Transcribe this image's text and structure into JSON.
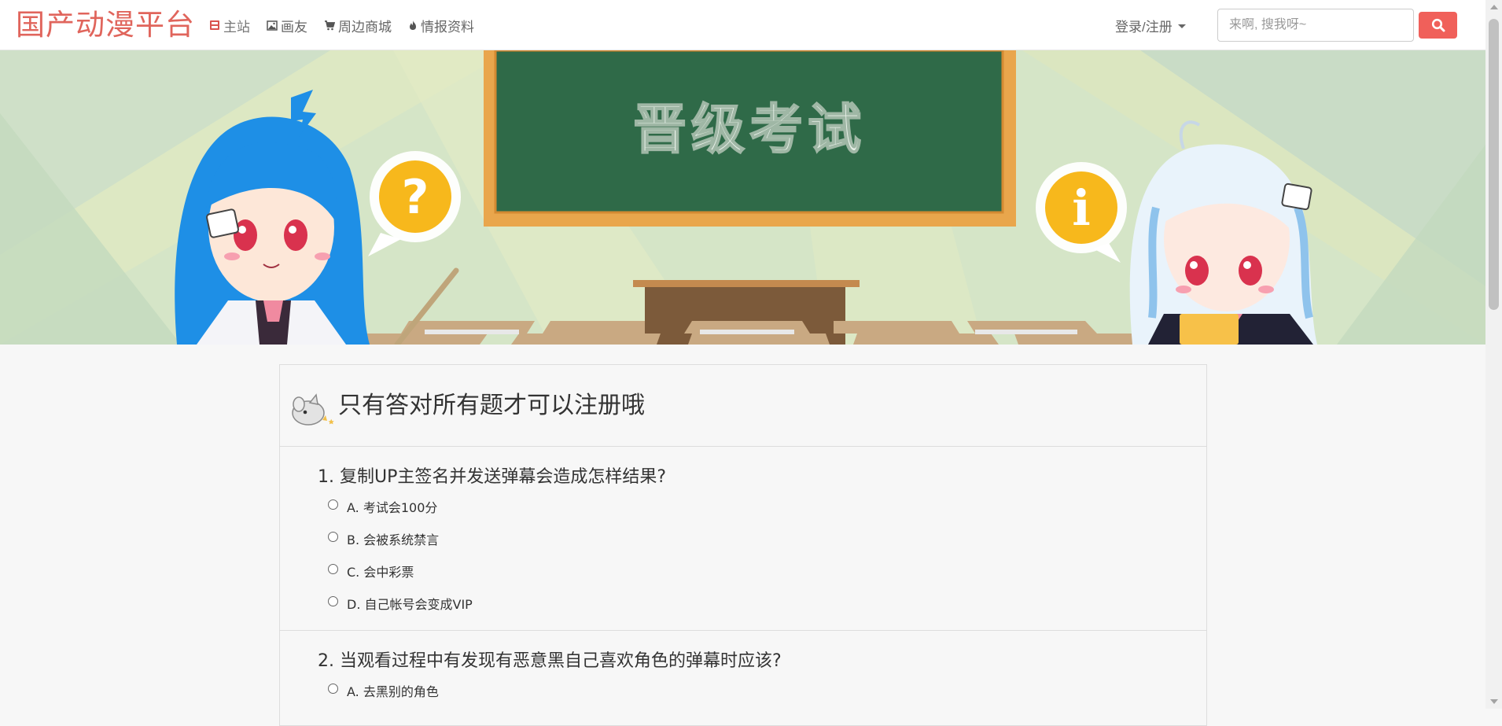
{
  "navbar": {
    "brand": "国产动漫平台",
    "items": [
      {
        "label": "主站",
        "icon": "film-icon",
        "active": true
      },
      {
        "label": "画友",
        "icon": "picture-icon",
        "active": false
      },
      {
        "label": "周边商城",
        "icon": "cart-icon",
        "active": false
      },
      {
        "label": "情报资料",
        "icon": "fire-icon",
        "active": false
      }
    ],
    "login_label": "登录/注册",
    "search_placeholder": "来啊, 搜我呀~"
  },
  "banner": {
    "board_text": "晋级考试",
    "image": "anime-exam-classroom-banner"
  },
  "exam": {
    "title": "只有答对所有题才可以注册哦",
    "questions": [
      {
        "title": "1. 复制UP主签名并发送弹幕会造成怎样结果?",
        "options": [
          "A. 考试会100分",
          "B. 会被系统禁言",
          "C. 会中彩票",
          "D. 自己帐号会变成VIP"
        ]
      },
      {
        "title": "2. 当观看过程中有发现有恶意黑自己喜欢角色的弹幕时应该?",
        "options": [
          "A. 去黑别的角色"
        ]
      }
    ]
  },
  "colors": {
    "brand": "#e0655c",
    "accent_button": "#f0605a",
    "board_green": "#2f6a48",
    "board_frame": "#e9a64c"
  }
}
